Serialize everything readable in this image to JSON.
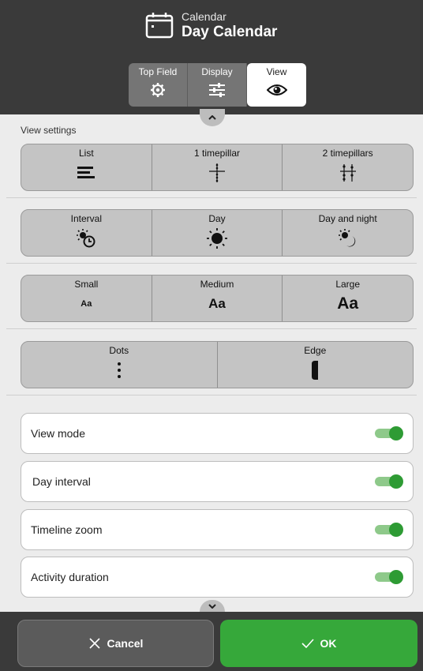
{
  "header": {
    "subtitle": "Calendar",
    "title": "Day Calendar",
    "tabs": [
      {
        "label": "Top Field",
        "icon": "gear-icon",
        "active": false
      },
      {
        "label": "Display",
        "icon": "sliders-icon",
        "active": false
      },
      {
        "label": "View",
        "icon": "eye-icon",
        "active": true
      }
    ]
  },
  "settings": {
    "section_label": "View settings",
    "view_type": [
      {
        "label": "List",
        "icon": "list-icon"
      },
      {
        "label": "1 timepillar",
        "icon": "one-timepillar-icon"
      },
      {
        "label": "2 timepillars",
        "icon": "two-timepillars-icon"
      }
    ],
    "day_span": [
      {
        "label": "Interval",
        "icon": "interval-icon"
      },
      {
        "label": "Day",
        "icon": "sun-icon"
      },
      {
        "label": "Day and night",
        "icon": "day-night-icon"
      }
    ],
    "text_size": [
      {
        "label": "Small",
        "sample": "Aa"
      },
      {
        "label": "Medium",
        "sample": "Aa"
      },
      {
        "label": "Large",
        "sample": "Aa"
      }
    ],
    "indicator": [
      {
        "label": "Dots",
        "icon": "dots-icon"
      },
      {
        "label": "Edge",
        "icon": "edge-icon"
      }
    ],
    "toggles": [
      {
        "label": "View mode",
        "on": true
      },
      {
        "label": "Day interval",
        "on": true
      },
      {
        "label": "Timeline zoom",
        "on": true
      },
      {
        "label": "Activity duration",
        "on": true
      }
    ]
  },
  "footer": {
    "cancel_label": "Cancel",
    "ok_label": "OK"
  },
  "colors": {
    "header_bg": "#3a3a3a",
    "ok_green": "#36a83a",
    "toggle_on": "#2e9b34"
  }
}
